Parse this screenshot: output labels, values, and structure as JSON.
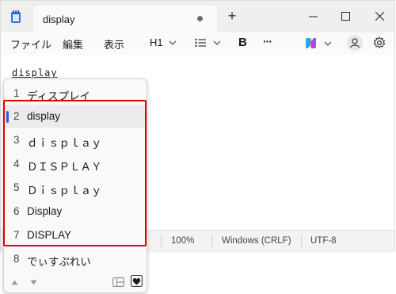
{
  "tab": {
    "title": "display"
  },
  "menu": {
    "file": "ファイル",
    "edit": "編集",
    "view": "表示"
  },
  "toolbar": {
    "heading": "H1",
    "bold": "B",
    "more": "···"
  },
  "editor": {
    "text": "display"
  },
  "statusbar": {
    "zoom": "100%",
    "line_ending": "Windows (CRLF)",
    "encoding": "UTF-8"
  },
  "ime": {
    "candidates": [
      {
        "num": "1",
        "text": "ディスプレイ"
      },
      {
        "num": "2",
        "text": "display"
      },
      {
        "num": "3",
        "text": "ｄｉｓｐｌａｙ"
      },
      {
        "num": "4",
        "text": "ＤＩＳＰＬＡＹ"
      },
      {
        "num": "5",
        "text": "Ｄｉｓｐｌａｙ"
      },
      {
        "num": "6",
        "text": "Display"
      },
      {
        "num": "7",
        "text": "DISPLAY"
      },
      {
        "num": "8",
        "text": "でぃすぷれい"
      }
    ],
    "selected_index": 1
  },
  "colors": {
    "accent": "#2160d4",
    "highlight": "#e00000",
    "copilot": "#8a5cf6"
  }
}
